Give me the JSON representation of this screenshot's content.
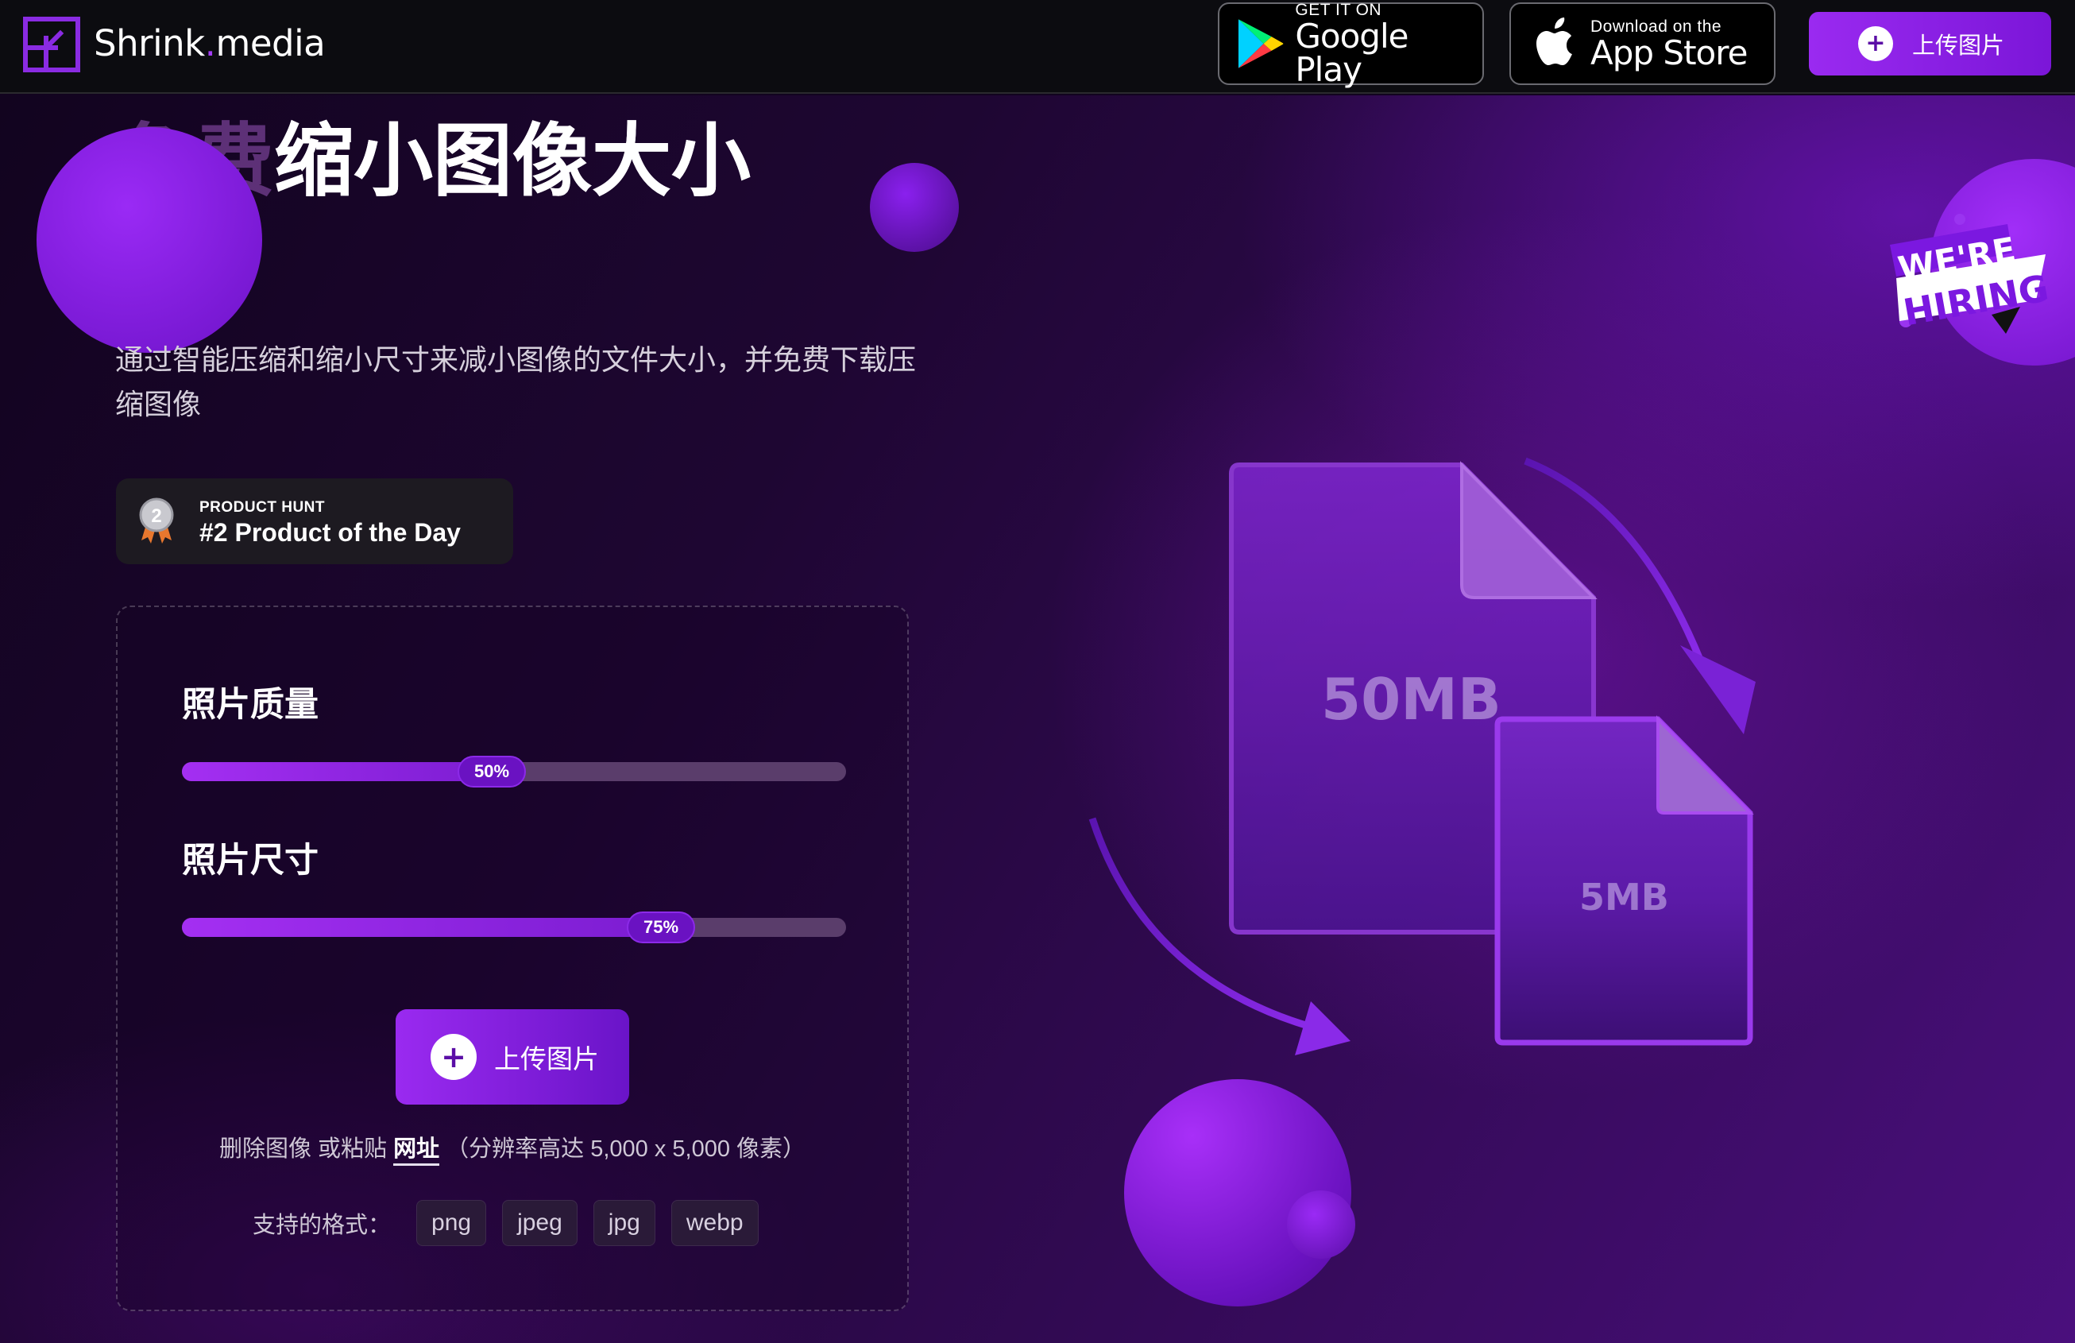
{
  "header": {
    "brand_name": "Shrink",
    "brand_dot": ".",
    "brand_suffix": "media",
    "google_play": {
      "small": "GET IT ON",
      "big": "Google Play"
    },
    "app_store": {
      "small": "Download on the",
      "big": "App Store"
    },
    "upload_label": "上传图片"
  },
  "hero": {
    "title_faded": "免费",
    "title_solid": "缩小图像大小",
    "description": "通过智能压缩和缩小尺寸来减小图像的文件大小，并免费下载压缩图像"
  },
  "product_hunt": {
    "medal_number": "2",
    "label": "PRODUCT HUNT",
    "title": "#2 Product of the Day"
  },
  "settings": {
    "quality": {
      "label": "照片质量",
      "value": 50,
      "value_text": "50%"
    },
    "size": {
      "label": "照片尺寸",
      "value": 75,
      "value_text": "75%"
    },
    "upload_label": "上传图片",
    "paste_before": "删除图像 或粘贴 ",
    "paste_link": "网址",
    "paste_after": " （分辨率高达 5,000 x 5,000 像素）",
    "formats_label": "支持的格式：",
    "formats": [
      "png",
      "jpeg",
      "jpg",
      "webp"
    ]
  },
  "illustration": {
    "large_file": "50MB",
    "small_file": "5MB"
  },
  "hiring": {
    "line1": "WE'RE",
    "line2": "HIRING"
  },
  "colors": {
    "accent": "#9a2af0",
    "background": "#12041f",
    "header_bg": "#0c0c10"
  }
}
